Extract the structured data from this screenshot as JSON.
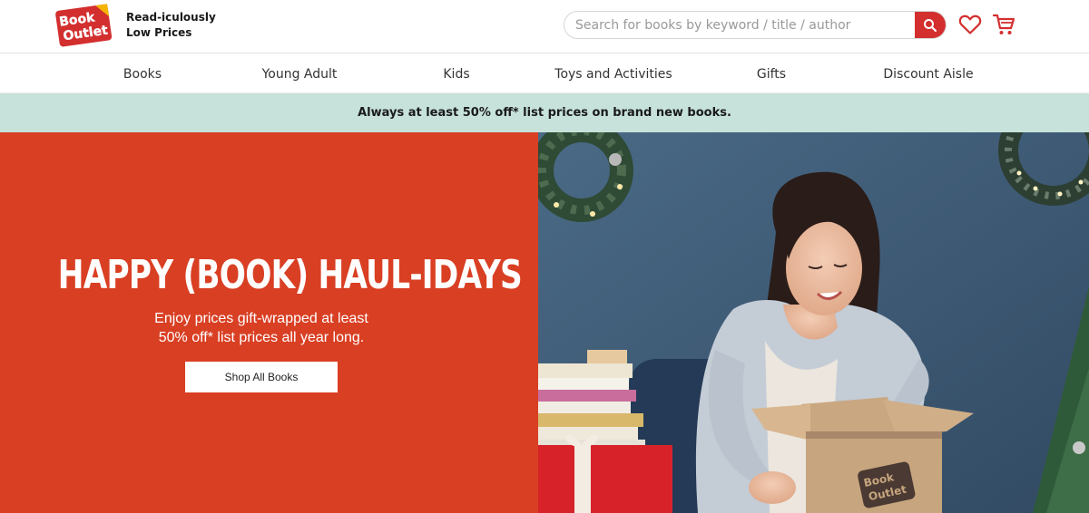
{
  "brand": {
    "logo_top": "Book",
    "logo_bottom": "Outlet",
    "tagline_line1": "Read-iculously",
    "tagline_line2": "Low Prices"
  },
  "search": {
    "placeholder": "Search for books by keyword / title / author",
    "value": "",
    "button_icon": "search-icon"
  },
  "header_icons": [
    "heart-icon",
    "cart-icon"
  ],
  "nav": {
    "items": [
      {
        "label": "Books"
      },
      {
        "label": "Young Adult"
      },
      {
        "label": "Kids"
      },
      {
        "label": "Toys and Activities"
      },
      {
        "label": "Gifts"
      },
      {
        "label": "Discount Aisle"
      }
    ]
  },
  "promo": {
    "text": "Always at least 50% off* list prices on brand new books."
  },
  "hero": {
    "title": "HAPPY (BOOK) HAUL-IDAYS",
    "subtitle_line1": "Enjoy prices gift-wrapped at least",
    "subtitle_line2": "50% off* list prices all year long.",
    "cta": "Shop All Books",
    "box_logo_top": "Book",
    "box_logo_bottom": "Outlet"
  },
  "colors": {
    "brand_red": "#d32f2f",
    "hero_red": "#d93f23",
    "promo_bg": "#c6e2da",
    "photo_wall": "#3f5d78"
  }
}
